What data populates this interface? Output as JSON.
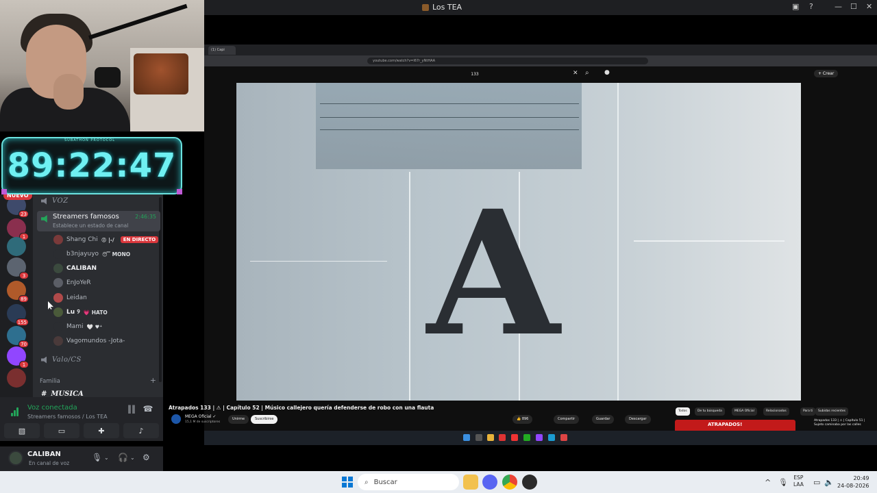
{
  "window": {
    "title": "Los TEA"
  },
  "timer": {
    "label": "SUBATHON PROTOCOL",
    "time": "89:22:47"
  },
  "guilds": [
    {
      "badge": "23",
      "color": "#3e4a6b"
    },
    {
      "badge": "1",
      "color": "#8a2f4e"
    },
    {
      "badge": "",
      "color": "#2f6b7a"
    },
    {
      "badge": "3",
      "color": "#5c6470"
    },
    {
      "badge": "89",
      "color": "#b05a2a"
    },
    {
      "badge": "155",
      "color": "#2a3b55"
    },
    {
      "badge": "70",
      "color": "#2e6f8f"
    },
    {
      "badge": "1",
      "color": "#9146ff"
    },
    {
      "badge": "NUEVO",
      "color": "#7a2f2f"
    }
  ],
  "channels": {
    "category_voz": "VOZ",
    "active_voice": {
      "name": "Streamers famosos",
      "status": "Establece un estado de canal",
      "duration": "2:46:35"
    },
    "members": [
      {
        "name": "Shang Chi",
        "emoji": "😡 |-/",
        "badge": "EN DIRECTO",
        "bright": false,
        "color": "#7a3a3a"
      },
      {
        "name": "b3njayuyo",
        "emoji": "😴 MONO",
        "badge": "",
        "bright": false,
        "color": "#2b2d31"
      },
      {
        "name": "CALIBAN",
        "emoji": "",
        "badge": "",
        "bright": true,
        "color": "#3b4a3e"
      },
      {
        "name": "EnJoYeR",
        "emoji": "",
        "badge": "",
        "bright": false,
        "color": "#5b5e66"
      },
      {
        "name": "Leidan",
        "emoji": "",
        "badge": "",
        "bright": false,
        "color": "#b04a4a"
      },
      {
        "name": "Lu ୨",
        "emoji": "💗 HATO",
        "badge": "",
        "bright": true,
        "color": "#4a5a3a"
      },
      {
        "name": "Mami",
        "emoji": "🤍 ♥⁺",
        "badge": "",
        "bright": false,
        "color": "#2b2d31"
      },
      {
        "name": "Vagomundos -Jota-",
        "emoji": "",
        "badge": "",
        "bright": false,
        "color": "#4a3a3a"
      }
    ],
    "category_valo": "Valo/CS",
    "section_familia": "Familia",
    "channel_musica": "MUSICA"
  },
  "voice_panel": {
    "title": "Voz conectada",
    "subtitle": "Streamers famosos / Los TEA"
  },
  "user_panel": {
    "name": "CALIBAN",
    "status": "En canal de voz"
  },
  "browser": {
    "tab": "(1) Capi",
    "url": "youtube.com/watch?v=l67r_yNtHAA",
    "search": "133",
    "create": "+ Crear"
  },
  "video": {
    "letter": "A"
  },
  "youtube": {
    "title": "Atrapados 133  |  ⚠ | Capítulo 52 | Músico callejero quería defenderse de robo con una flauta",
    "channel": "MEGA Oficial ✓",
    "subs": "15,1 M de suscriptores",
    "join": "Unirme",
    "subscribe": "Suscribirse",
    "likes": "👍 896",
    "share": "Compartir",
    "save": "Guardar",
    "download": "Descargar",
    "chips": [
      "Todos",
      "De tu búsqueda",
      "MEGA Oficial",
      "Relacionados",
      "Para ti",
      "Subidas recientes"
    ],
    "thumb_text": "ATRAPADOS!",
    "side_title": "Atrapados 133  |  ⚠ | Capítulo 51 | Sujeto caminaba por las calles"
  },
  "taskbar": {
    "search": "Buscar",
    "lang_top": "ESP",
    "lang_bottom": "LAA",
    "time": "20:49",
    "date": "24-08-2026"
  }
}
